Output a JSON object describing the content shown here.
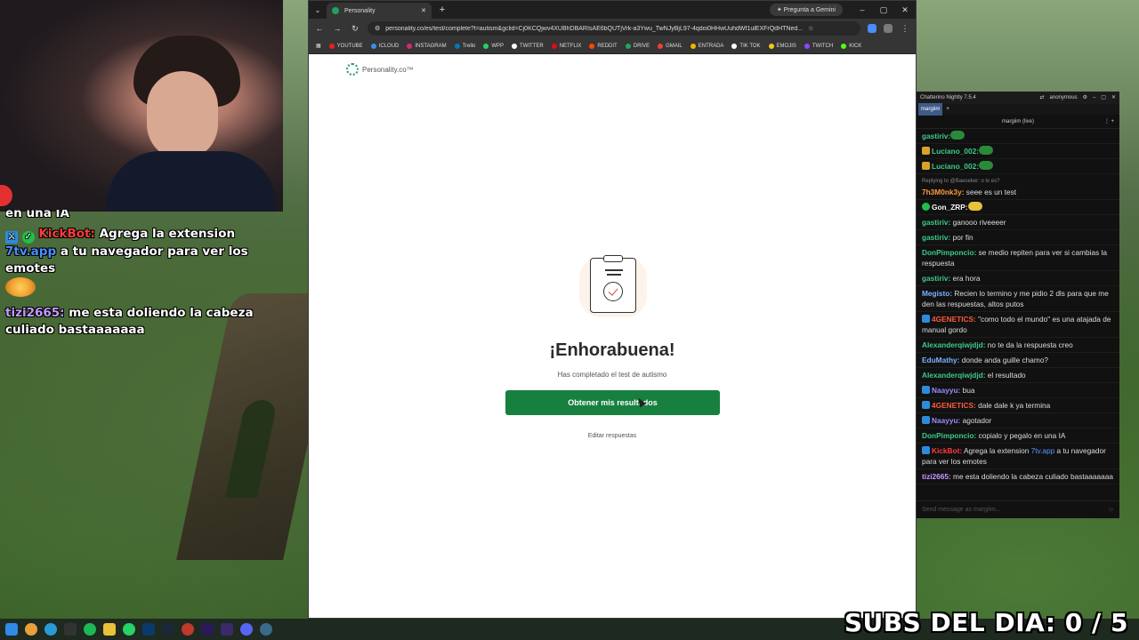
{
  "stream_chat": {
    "cut_line": "en una IA",
    "messages": [
      {
        "user": "KickBot:",
        "text_a": " Agrega la extension ",
        "link": "7tv.app",
        "text_b": " a tu navegador para ver los emotes"
      },
      {
        "user": "tizi2665:",
        "text": " me esta doliendo la cabeza culiado bastaaaaaaa"
      }
    ]
  },
  "browser": {
    "tab_title": "Personality",
    "gemini_label": "Pregunta a Gemini",
    "url": "personality.co/es/test/complete?t=autism&gclid=Cj0KCQjwv4XUBhDBARIsAE6bQUTjVrk-a3Ywu_TwNJyBjL97-4qdoi0HHwUuhdWf1ulEXFrQdHTNed...",
    "bookmarks": [
      "YOUTUBE",
      "ICLOUD",
      "INSTAGRAM",
      "Trello",
      "WPP",
      "TWITTER",
      "NETFLIX",
      "REDDIT",
      "DRIVE",
      "GMAIL",
      "ENTRADA",
      "TIK TOK",
      "EMOJIS",
      "TWITCH",
      "KICK"
    ],
    "bookmark_colors": [
      "#e62117",
      "#3b8eea",
      "#d62976",
      "#0079bf",
      "#25d366",
      "#ffffff",
      "#e50914",
      "#ff4500",
      "#1fa463",
      "#ea4335",
      "#f4b400",
      "#ffffff",
      "#f5c518",
      "#9146ff",
      "#53fc18"
    ]
  },
  "page": {
    "logo": "Personality.co™",
    "heading": "¡Enhorabuena!",
    "subtext": "Has completado el test de autismo",
    "cta": "Obtener mis resultados",
    "edit": "Editar respuestas"
  },
  "chatterino": {
    "window_title": "Chatterino Nightly 7.5.4",
    "account": "anonymous",
    "tab": "margiim",
    "channel_header": "margiim (live)",
    "input_placeholder": "Send message as margiim...",
    "messages": [
      {
        "user": "gastiriv:",
        "color": "#3ec98a",
        "text": ""
      },
      {
        "user": "Luciano_002:",
        "color": "#3ec98a",
        "text": ""
      },
      {
        "user": "Luciano_002:",
        "color": "#3ec98a",
        "text": ""
      },
      {
        "reply": "Replying to @Baeseker: o lo es?",
        "user": "7h3M0nk3y:",
        "color": "#ff9a3c",
        "text": " seee es un test"
      },
      {
        "user": "Gon_ZRP:",
        "color": "#f7f7f7",
        "text": ""
      },
      {
        "user": "gastiriv:",
        "color": "#3ec98a",
        "text": " ganooo riveeeer"
      },
      {
        "user": "gastiriv:",
        "color": "#3ec98a",
        "text": " por fin"
      },
      {
        "user": "DonPimponcio:",
        "color": "#3ec98a",
        "text": " se medio repiten para ver si cambias la respuesta"
      },
      {
        "user": "gastiriv:",
        "color": "#3ec98a",
        "text": " era hora"
      },
      {
        "user": "Megisto:",
        "color": "#7ab2ff",
        "text": " Recien lo termino y me pidio 2 dls para que me den las respuestas, altos putos"
      },
      {
        "user": "4GENETICS:",
        "color": "#ff5a3c",
        "text": " \"como todo el mundo\" es una atajada de manual gordo"
      },
      {
        "user": "Alexanderqiwjdjd:",
        "color": "#3ec98a",
        "text": " no te da la respuesta creo"
      },
      {
        "user": "EduMathy:",
        "color": "#7ab2ff",
        "text": " donde anda guille chamo?"
      },
      {
        "user": "Alexanderqiwjdjd:",
        "color": "#3ec98a",
        "text": " el resultado"
      },
      {
        "user": "Naayyu:",
        "color": "#9a8bff",
        "text": " bua"
      },
      {
        "user": "4GENETICS:",
        "color": "#ff5a3c",
        "text": " dale dale k ya termina"
      },
      {
        "user": "Naayyu:",
        "color": "#9a8bff",
        "text": " agotador"
      },
      {
        "user": "DonPimponcio:",
        "color": "#3ec98a",
        "text": " copialo y pegalo en una IA"
      },
      {
        "user": "KickBot:",
        "color": "#ff3b3b",
        "text": " Agrega la extension ",
        "link": "7tv.app",
        "text_b": " a tu navegador para ver los emotes"
      },
      {
        "user": "tizi2665:",
        "color": "#c49bff",
        "text": " me esta doliendo la cabeza culiado bastaaaaaaa"
      }
    ]
  },
  "overlay": {
    "subs": "SUBS DEL DIA: 0 / 5"
  }
}
